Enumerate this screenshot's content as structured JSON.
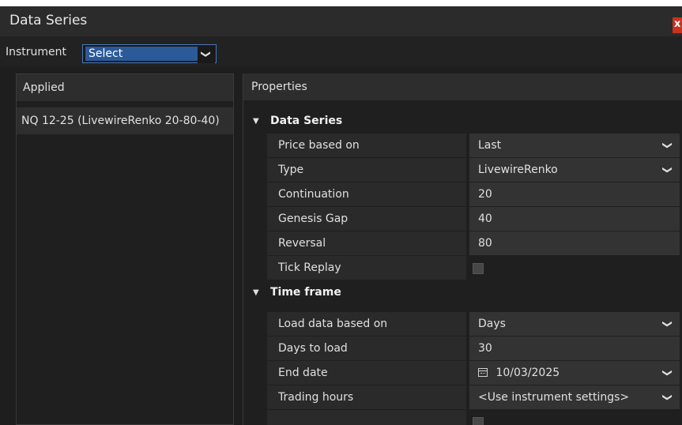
{
  "window": {
    "title": "Data Series",
    "close_glyph": "x"
  },
  "instrument": {
    "label": "Instrument",
    "value": "Select"
  },
  "applied": {
    "header": "Applied",
    "items": [
      "NQ 12-25 (LivewireRenko 20-80-40)"
    ]
  },
  "properties": {
    "header": "Properties",
    "categories": {
      "data_series": {
        "label": "Data Series",
        "rows": {
          "price_based_on": {
            "name": "Price based on",
            "value": "Last"
          },
          "type": {
            "name": "Type",
            "value": "LivewireRenko"
          },
          "continuation": {
            "name": "Continuation",
            "value": "20"
          },
          "genesis_gap": {
            "name": "Genesis Gap",
            "value": "40"
          },
          "reversal": {
            "name": "Reversal",
            "value": "80"
          },
          "tick_replay": {
            "name": "Tick Replay",
            "checked": false
          }
        }
      },
      "time_frame": {
        "label": "Time frame",
        "rows": {
          "load_data_based_on": {
            "name": "Load data based on",
            "value": "Days"
          },
          "days_to_load": {
            "name": "Days to load",
            "value": "30"
          },
          "end_date": {
            "name": "End date",
            "value": "10/03/2025"
          },
          "trading_hours": {
            "name": "Trading hours",
            "value": "<Use instrument settings>"
          }
        }
      }
    }
  },
  "icons": {
    "dropdown": "chevron-down-icon",
    "category_toggle": "caret-down-icon",
    "calendar": "calendar-icon",
    "close": "close-icon"
  }
}
